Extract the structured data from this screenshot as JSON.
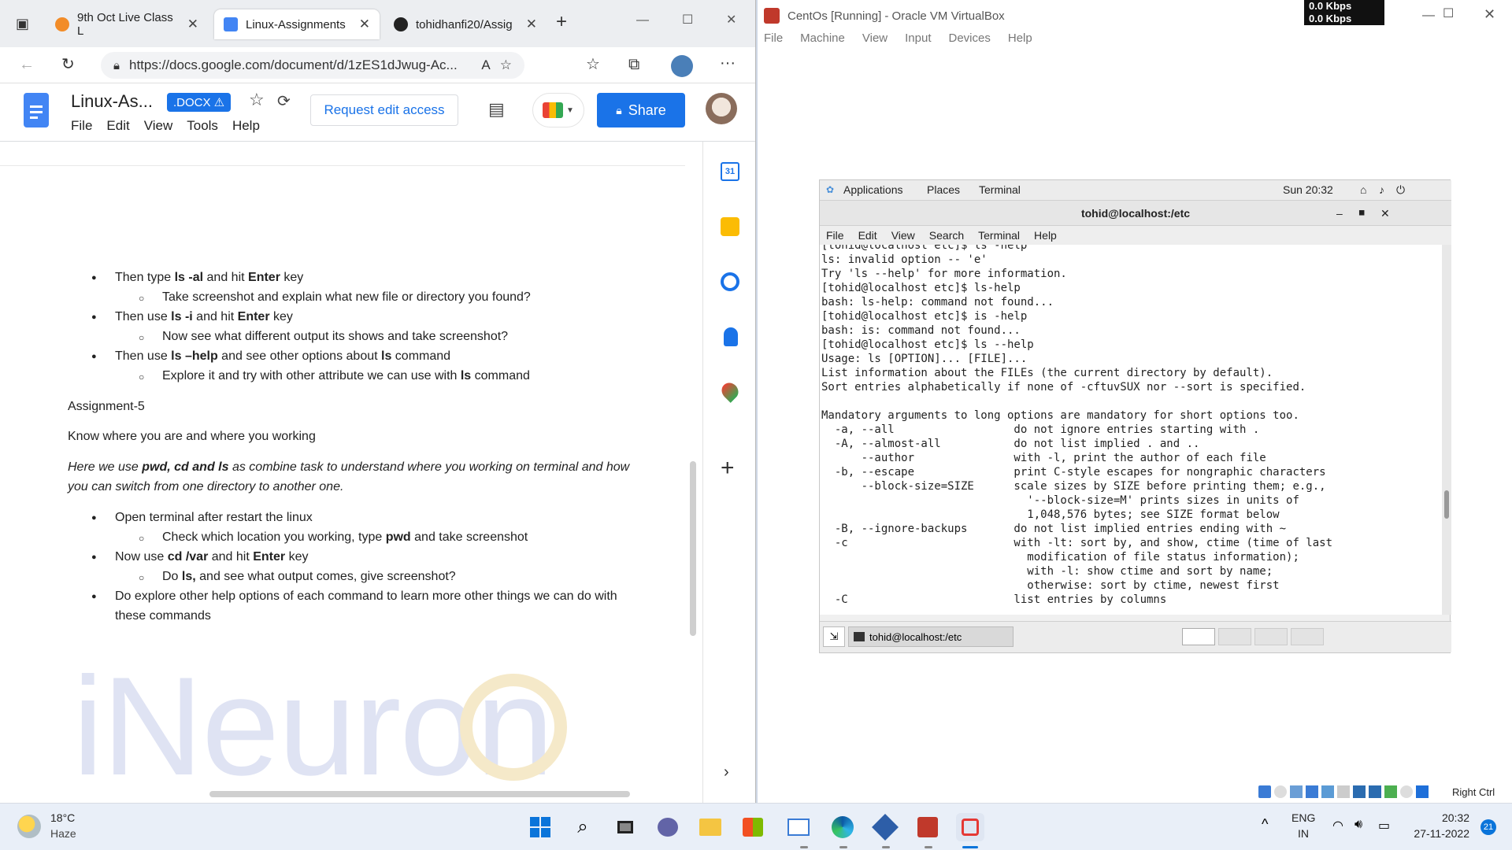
{
  "browser": {
    "tabs": [
      {
        "label": "9th Oct Live Class L",
        "favicon_color": "#f28c28"
      },
      {
        "label": "Linux-Assignments",
        "favicon_color": "#4285f4"
      },
      {
        "label": "tohidhanfi20/Assig",
        "favicon_color": "#222222"
      }
    ],
    "new_tab": "+",
    "url": "https://docs.google.com/document/d/1zES1dJwug-Ac...",
    "window_controls": {
      "minimize": "—",
      "maximize": "☐",
      "close": "✕"
    }
  },
  "docs": {
    "title": "Linux-As...",
    "badge": ".DOCX ⚠",
    "menu": [
      "File",
      "Edit",
      "View",
      "Tools",
      "Help"
    ],
    "request_edit": "Request edit access",
    "share": "Share",
    "watermark": "iNeuron"
  },
  "document": {
    "items": [
      {
        "kind": "bullet",
        "parts": [
          "Then type ",
          "ls -al",
          " and hit ",
          "Enter",
          " key"
        ]
      },
      {
        "kind": "sub",
        "parts": [
          "Take screenshot and explain what new file or directory you found?"
        ]
      },
      {
        "kind": "bullet",
        "parts": [
          "Then use ",
          "ls -i",
          " and hit ",
          "Enter",
          " key"
        ]
      },
      {
        "kind": "sub",
        "parts": [
          "Now see what different output its shows and take screenshot?"
        ]
      },
      {
        "kind": "bullet",
        "parts": [
          "Then use ",
          "ls –help",
          " and see other options about ",
          "ls",
          " command"
        ]
      },
      {
        "kind": "sub",
        "parts": [
          "Explore it and try with other attribute we can use with ",
          "ls",
          " command"
        ]
      },
      {
        "kind": "para",
        "parts": [
          "Assignment-5"
        ]
      },
      {
        "kind": "para",
        "parts": [
          "Know where you are and where you working"
        ]
      },
      {
        "kind": "italic",
        "parts": [
          "Here we use ",
          "pwd, cd and ls",
          " as combine task to understand where you working on terminal and how"
        ]
      },
      {
        "kind": "italic",
        "parts": [
          "you can switch from one directory to another one."
        ]
      },
      {
        "kind": "bullet",
        "parts": [
          " Open terminal after restart the linux"
        ]
      },
      {
        "kind": "sub",
        "parts": [
          "Check which location you working, type ",
          "pwd",
          " and take screenshot"
        ]
      },
      {
        "kind": "bullet",
        "parts": [
          "Now use ",
          "cd /var",
          " and hit ",
          "Enter",
          " key"
        ]
      },
      {
        "kind": "sub",
        "parts": [
          "Do ",
          "ls,",
          " and see what output comes, give screenshot?"
        ]
      },
      {
        "kind": "bullet",
        "parts": [
          "Do explore other help options of each command to learn more other things we can do with"
        ]
      },
      {
        "kind": "cont",
        "parts": [
          "these commands"
        ]
      }
    ]
  },
  "vbox": {
    "title": "CentOs [Running] - Oracle VM VirtualBox",
    "menu": [
      "File",
      "Machine",
      "View",
      "Input",
      "Devices",
      "Help"
    ],
    "net_up": "0.0 Kbps",
    "net_down": "0.0 Kbps",
    "host_key": "Right Ctrl"
  },
  "gnome": {
    "applications": "Applications",
    "places": "Places",
    "terminal": "Terminal",
    "clock": "Sun 20:32",
    "terminal_title": "tohid@localhost:/etc",
    "terminal_menu": [
      "File",
      "Edit",
      "View",
      "Search",
      "Terminal",
      "Help"
    ],
    "task_label": "tohid@localhost:/etc"
  },
  "terminal_lines": [
    "[tohid@localhost etc]$ ls -help",
    "ls: invalid option -- 'e'",
    "Try 'ls --help' for more information.",
    "[tohid@localhost etc]$ ls-help",
    "bash: ls-help: command not found...",
    "[tohid@localhost etc]$ is -help",
    "bash: is: command not found...",
    "[tohid@localhost etc]$ ls --help",
    "Usage: ls [OPTION]... [FILE]...",
    "List information about the FILEs (the current directory by default).",
    "Sort entries alphabetically if none of -cftuvSUX nor --sort is specified.",
    "",
    "Mandatory arguments to long options are mandatory for short options too.",
    "  -a, --all                  do not ignore entries starting with .",
    "  -A, --almost-all           do not list implied . and ..",
    "      --author               with -l, print the author of each file",
    "  -b, --escape               print C-style escapes for nongraphic characters",
    "      --block-size=SIZE      scale sizes by SIZE before printing them; e.g.,",
    "                               '--block-size=M' prints sizes in units of",
    "                               1,048,576 bytes; see SIZE format below",
    "  -B, --ignore-backups       do not list implied entries ending with ~",
    "  -c                         with -lt: sort by, and show, ctime (time of last",
    "                               modification of file status information);",
    "                               with -l: show ctime and sort by name;",
    "                               otherwise: sort by ctime, newest first",
    "  -C                         list entries by columns"
  ],
  "taskbar": {
    "weather_temp": "18°C",
    "weather_desc": "Haze",
    "lang1": "ENG",
    "lang2": "IN",
    "time": "20:32",
    "date": "27-11-2022",
    "notif_count": "21"
  }
}
